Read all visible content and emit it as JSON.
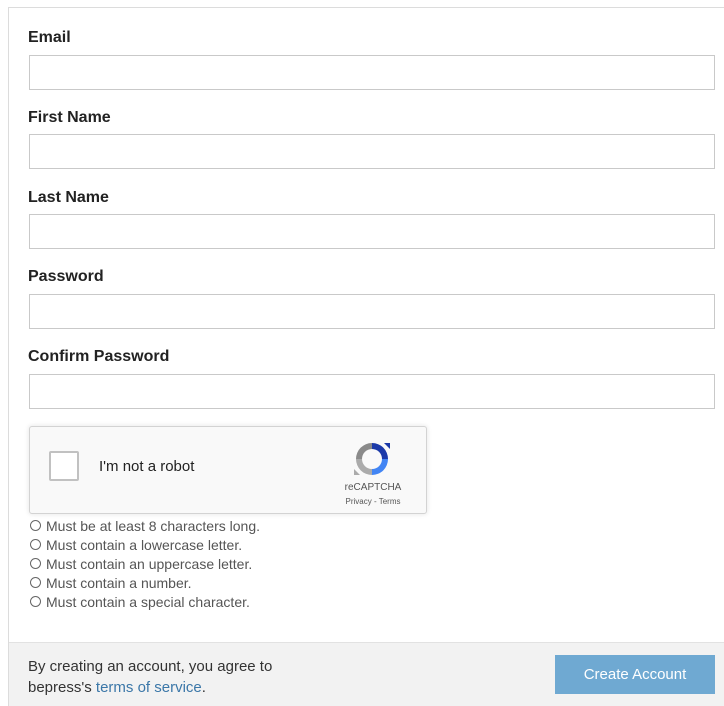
{
  "form": {
    "email_label": "Email",
    "first_name_label": "First Name",
    "last_name_label": "Last Name",
    "password_label": "Password",
    "confirm_password_label": "Confirm Password",
    "email_value": "",
    "first_name_value": "",
    "last_name_value": "",
    "password_value": "",
    "confirm_password_value": ""
  },
  "recaptcha": {
    "checkbox_text": "I'm not a robot",
    "brand": "reCAPTCHA",
    "privacy": "Privacy",
    "separator": " - ",
    "terms": "Terms",
    "logo_icon": "recaptcha-logo-icon"
  },
  "password_rules": [
    "Must be at least 8 characters long.",
    "Must contain a lowercase letter.",
    "Must contain an uppercase letter.",
    "Must contain a number.",
    "Must contain a special character."
  ],
  "footer": {
    "agree_text_1": "By creating an account, you agree to",
    "agree_text_2": "bepress's ",
    "terms_link": "terms of service",
    "agree_text_3": ".",
    "create_button": "Create Account"
  },
  "colors": {
    "accent_button": "#6fa9d2",
    "link": "#3b77a8",
    "footer_bg": "#f2f2f2"
  }
}
